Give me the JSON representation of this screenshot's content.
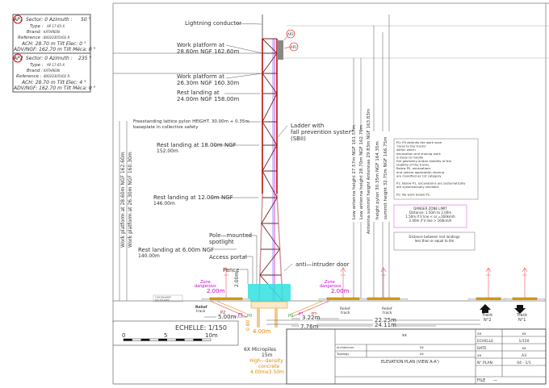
{
  "antennas": [
    {
      "id": "AP1",
      "sector": "Sector:  0  Azimuth :",
      "azimuth": "50 °",
      "type_label": "Type :",
      "type": "AP 17-65-X",
      "brand_label": "Brand:",
      "brand": "KATHREIN",
      "ref_label": "Reference :",
      "reference": "80010305V02 R",
      "ach": "ACH:   28.70 m   Tilt Elec:  0 °",
      "adv": "ADV/NGF:  162.70 m  Tilt Méca:  0 °"
    },
    {
      "id": "AP2",
      "sector": "Sector:  0  Azimuth :",
      "azimuth": "235 °",
      "type_label": "Type :",
      "type": "AP 17-65-X",
      "brand_label": "Brand :",
      "brand": "KATHREIN",
      "ref_label": "Reference :",
      "reference": "80010305V02 R",
      "ach": "ACH:   28.70 m   Tilt Elec:  4 °",
      "adv": "ADV/NGF:  162.70 m  Tilt Méca:  0 °"
    }
  ],
  "labels": {
    "lightning": "Lightning conductor",
    "wp1a": "Work platform at",
    "wp1b": "28.60m  NGF 162.60m",
    "wp2a": "Work platform at",
    "wp2b": "26.30m  NGF 160.30m",
    "rl24a": "Rest landing at",
    "rl24b": "24.00m  NGF 158.00m",
    "pylon_a": "Freestanding lattice pylon HEIGHT. 30.00m + 0.35m",
    "pylon_b": "baseplate in collective safety",
    "ladder_a": "Ladder with",
    "ladder_b": "fall prevention system",
    "ladder_c": "(SBII)",
    "rl18a": "Rest landing at 18.00m NGF",
    "rl18b": "152.00m",
    "rl12a": "Rest landing at 12.00m NGF",
    "rl12b": "146.00m",
    "rl6a": "Rest landing at 6.00m NGF",
    "rl6b": "140.00m",
    "spot_a": "Pole—mounted",
    "spot_b": "spotlight",
    "portal": "Access portal",
    "fence": "Fence",
    "door": "anti—intruder door",
    "vert1": "Work platform at 28.60m  NGF 162.60m",
    "vert2": "Work platform at 26.30m  NGF 160.30m",
    "h1": "Low antenna height 27.57m NGF 161.57m",
    "h2": "Low antenna height 28.70m NGF 162.70m",
    "h3": "Antenna summit height Antennas 29.83m NGF 163.83m",
    "h4": "height pylon 30.35m NGF 164.35m",
    "h5": "summit height 32.75m NGF 166.75m",
    "ap1": "AP1",
    "ap2": "AP2",
    "zone_a": "Zone",
    "zone_b": "dangerous",
    "zone_d": "2.00m",
    "fence_h": "2.00m",
    "relief": "Relief",
    "track": "track",
    "ngf": "134.00mNGF",
    "sol": "Sol ±0.00m",
    "p1": "P1",
    "p2": "P2",
    "p0": "P0",
    "d500": "5.00m",
    "d322": "3.22m",
    "d776": "7.76m",
    "d2225": "22.25m",
    "d2411": "24.11m",
    "d400": "4.00m",
    "d080": "0.80",
    "micro_a": "6X Micropiles",
    "micro_b": "15m",
    "conc_a": "High—density",
    "conc_b": "concrete",
    "conc_c": "4.00mx3.50m",
    "track2": "Track",
    "track2n": "N°2",
    "track1": "Track",
    "track1n": "N°1"
  },
  "notes": {
    "p0": [
      "P0: P0 delimits the work zone",
      "'close to the tracks'",
      "within which",
      "excavation and shoring work",
      "is likely to modify",
      "the geometry and/or stability of the",
      "stability of the tracks.",
      "Below P0, excavations",
      "and (where applicable) shoring",
      "are classified as 1st category.",
      "",
      "P1: Below P1, excavations are systematically",
      "are systematically shielded.",
      "",
      "P2: No work below P2."
    ],
    "danger": [
      "DANGER ZONE LIMIT",
      "Distance: 1.50m to 2.00m",
      "1.50m if V line < or =160km/h",
      "2.00m if V line > 160km/h"
    ],
    "distance": [
      "Distance between rest landings",
      "less than or equal to 6m"
    ]
  },
  "scale": {
    "title": "ECHELLE:  1/150",
    "ticks": [
      "0",
      "5",
      "10m"
    ]
  },
  "titleblock": {
    "main": "xx",
    "arch_label": "Architecture",
    "arch_val": "xx",
    "topo_label": "Topology",
    "topo_val": "xx",
    "plan_title": "ELEVATION PLAN (VIEW A-A')",
    "rows": [
      [
        "xx",
        "xx"
      ],
      [
        "ECHELLE",
        "1/150"
      ],
      [
        "DATE",
        "xx"
      ],
      [
        "xx",
        "A3"
      ],
      [
        "N° PLAN",
        "04   -   1/1"
      ]
    ],
    "file_label": "FILE",
    "file_val": "—"
  },
  "colors": {
    "tower": "#b00000",
    "magenta": "#d000d0",
    "orange": "#e08a00",
    "cyan": "#30e0e0",
    "track": "#e0a000"
  }
}
